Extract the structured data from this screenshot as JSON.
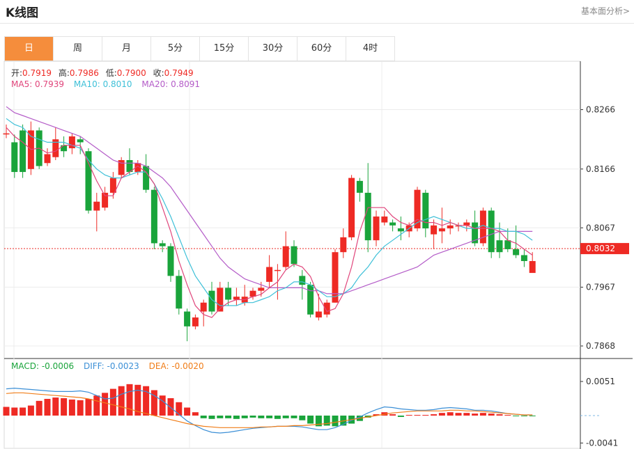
{
  "header": {
    "title": "K线图",
    "link": "基本面分析>"
  },
  "tabs": [
    "日",
    "周",
    "月",
    "5分",
    "15分",
    "30分",
    "60分",
    "4时"
  ],
  "active_tab": 0,
  "ohlc_labels": {
    "open_label": "开:",
    "open": "0.7919",
    "high_label": "高:",
    "high": "0.7986",
    "low_label": "低:",
    "low": "0.7900",
    "close_label": "收:",
    "close": "0.7949"
  },
  "ma_labels": {
    "ma5": "MA5: 0.7939",
    "ma10": "MA10: 0.8010",
    "ma20": "MA20: 0.8091"
  },
  "macd_labels": {
    "macd": "MACD: -0.0006",
    "diff": "DIFF: -0.0023",
    "dea": "DEA: -0.0020"
  },
  "price_axis": {
    "ticks": [
      0.8266,
      0.8166,
      0.8067,
      0.7967,
      0.7868
    ],
    "tick_labels": [
      "0.8266",
      "0.8166",
      "0.8067",
      "0.7967",
      "0.7868"
    ],
    "current_price": 0.8032,
    "current_label": "0.8032"
  },
  "macd_axis": {
    "ticks": [
      0.0051,
      -0.0041
    ],
    "tick_labels": [
      "0.0051",
      "-0.0041"
    ]
  },
  "colors": {
    "up": "#ee2a24",
    "down": "#1aa43b",
    "ma5": "#e0457b",
    "ma10": "#3ec0d8",
    "ma20": "#b45cc8",
    "diff": "#3b8fd6",
    "dea": "#f07d18",
    "accent": "#f58d3c"
  },
  "chart_data": {
    "type": "candlestick",
    "candles": [
      [
        0.8226,
        0.8226,
        0.8241,
        0.8218
      ],
      [
        0.8211,
        0.8161,
        0.8224,
        0.8151
      ],
      [
        0.8231,
        0.8161,
        0.8241,
        0.8151
      ],
      [
        0.8166,
        0.8231,
        0.8246,
        0.8156
      ],
      [
        0.8231,
        0.8171,
        0.8236,
        0.8166
      ],
      [
        0.8176,
        0.8191,
        0.8201,
        0.8171
      ],
      [
        0.8186,
        0.8216,
        0.8236,
        0.8181
      ],
      [
        0.8206,
        0.8196,
        0.8221,
        0.8186
      ],
      [
        0.8201,
        0.8221,
        0.8226,
        0.8191
      ],
      [
        0.8216,
        0.8211,
        0.8221,
        0.8191
      ],
      [
        0.8196,
        0.8096,
        0.8201,
        0.8091
      ],
      [
        0.8096,
        0.8111,
        0.8126,
        0.8061
      ],
      [
        0.8101,
        0.8126,
        0.8136,
        0.8096
      ],
      [
        0.8126,
        0.8151,
        0.8161,
        0.8116
      ],
      [
        0.8156,
        0.8181,
        0.8186,
        0.8151
      ],
      [
        0.8181,
        0.8161,
        0.8201,
        0.8156
      ],
      [
        0.8161,
        0.8176,
        0.8181,
        0.8156
      ],
      [
        0.8171,
        0.8131,
        0.8191,
        0.8126
      ],
      [
        0.8131,
        0.8041,
        0.8136,
        0.8031
      ],
      [
        0.8041,
        0.8036,
        0.8046,
        0.8026
      ],
      [
        0.8036,
        0.7986,
        0.8041,
        0.7976
      ],
      [
        0.7986,
        0.7931,
        0.7996,
        0.7921
      ],
      [
        0.7926,
        0.7901,
        0.7931,
        0.7876
      ],
      [
        0.7901,
        0.7916,
        0.7921,
        0.7896
      ],
      [
        0.7926,
        0.7941,
        0.7946,
        0.7901
      ],
      [
        0.7961,
        0.7926,
        0.7976,
        0.7921
      ],
      [
        0.7926,
        0.7966,
        0.7976,
        0.7926
      ],
      [
        0.7966,
        0.7946,
        0.7976,
        0.7936
      ],
      [
        0.7946,
        0.7951,
        0.7966,
        0.7936
      ],
      [
        0.7941,
        0.7951,
        0.7971,
        0.7936
      ],
      [
        0.7951,
        0.7961,
        0.7966,
        0.7946
      ],
      [
        0.7961,
        0.7966,
        0.7976,
        0.7951
      ],
      [
        0.7976,
        0.8001,
        0.8021,
        0.7966
      ],
      [
        0.7996,
        0.7996,
        0.8006,
        0.7946
      ],
      [
        0.8001,
        0.8036,
        0.8061,
        0.7996
      ],
      [
        0.8036,
        0.8006,
        0.8046,
        0.8001
      ],
      [
        0.7986,
        0.7971,
        0.7996,
        0.7946
      ],
      [
        0.7971,
        0.7921,
        0.7976,
        0.7916
      ],
      [
        0.7916,
        0.7926,
        0.7956,
        0.7911
      ],
      [
        0.7921,
        0.7941,
        0.7946,
        0.7916
      ],
      [
        0.7941,
        0.8026,
        0.8031,
        0.7941
      ],
      [
        0.8026,
        0.8051,
        0.8066,
        0.8016
      ],
      [
        0.8051,
        0.8151,
        0.8156,
        0.8046
      ],
      [
        0.8146,
        0.8126,
        0.8151,
        0.8111
      ],
      [
        0.8126,
        0.8046,
        0.8176,
        0.8026
      ],
      [
        0.8046,
        0.8086,
        0.8096,
        0.8036
      ],
      [
        0.8076,
        0.8086,
        0.8096,
        0.8071
      ],
      [
        0.8076,
        0.8071,
        0.8081,
        0.8061
      ],
      [
        0.8066,
        0.8061,
        0.8086,
        0.8046
      ],
      [
        0.8061,
        0.8071,
        0.8076,
        0.8051
      ],
      [
        0.8066,
        0.8131,
        0.8136,
        0.8061
      ],
      [
        0.8126,
        0.8066,
        0.8131,
        0.8051
      ],
      [
        0.8056,
        0.8071,
        0.8081,
        0.8031
      ],
      [
        0.8061,
        0.8066,
        0.8101,
        0.8041
      ],
      [
        0.8066,
        0.8071,
        0.8081,
        0.8056
      ],
      [
        0.8071,
        0.8071,
        0.8076,
        0.8061
      ],
      [
        0.8071,
        0.8076,
        0.8081,
        0.8061
      ],
      [
        0.8076,
        0.8041,
        0.8096,
        0.8036
      ],
      [
        0.8041,
        0.8096,
        0.8101,
        0.8036
      ],
      [
        0.8096,
        0.8026,
        0.8101,
        0.8016
      ],
      [
        0.8046,
        0.8026,
        0.8076,
        0.8016
      ],
      [
        0.8046,
        0.8031,
        0.8066,
        0.8026
      ],
      [
        0.8031,
        0.8021,
        0.8071,
        0.8016
      ],
      [
        0.8021,
        0.8011,
        0.8031,
        0.8001
      ],
      [
        0.7991,
        0.8011,
        0.8026,
        0.8001
      ]
    ],
    "ma5": [
      0.8236,
      0.8221,
      0.8211,
      0.8199,
      0.8201,
      0.8193,
      0.8196,
      0.8206,
      0.8206,
      0.8206,
      0.8176,
      0.8146,
      0.8121,
      0.8121,
      0.8151,
      0.8161,
      0.8171,
      0.8161,
      0.8141,
      0.8101,
      0.8061,
      0.8011,
      0.7971,
      0.7936,
      0.7921,
      0.7916,
      0.7931,
      0.7941,
      0.7946,
      0.7946,
      0.7951,
      0.7955,
      0.7966,
      0.7976,
      0.7996,
      0.8006,
      0.8001,
      0.7985,
      0.7951,
      0.7926,
      0.7931,
      0.7956,
      0.8001,
      0.8061,
      0.8101,
      0.8101,
      0.8101,
      0.8086,
      0.8076,
      0.8071,
      0.8081,
      0.8076,
      0.8076,
      0.8071,
      0.8076,
      0.8071,
      0.8071,
      0.8066,
      0.8066,
      0.8066,
      0.8061,
      0.8046,
      0.8041,
      0.8031,
      0.8021
    ],
    "ma10": [
      0.8251,
      0.8241,
      0.8236,
      0.8221,
      0.8216,
      0.8211,
      0.8211,
      0.8211,
      0.8206,
      0.8201,
      0.8181,
      0.8166,
      0.8156,
      0.8151,
      0.8151,
      0.8156,
      0.8161,
      0.8161,
      0.8141,
      0.8116,
      0.8086,
      0.8051,
      0.8016,
      0.7986,
      0.7966,
      0.7946,
      0.7936,
      0.7936,
      0.7936,
      0.7941,
      0.7941,
      0.7946,
      0.7951,
      0.7961,
      0.7966,
      0.7976,
      0.7976,
      0.7971,
      0.7961,
      0.7951,
      0.7951,
      0.7956,
      0.7966,
      0.7986,
      0.8001,
      0.8021,
      0.8036,
      0.8046,
      0.8056,
      0.8066,
      0.8076,
      0.8081,
      0.8086,
      0.8081,
      0.8076,
      0.8071,
      0.8066,
      0.8066,
      0.8071,
      0.8066,
      0.8066,
      0.8061,
      0.8061,
      0.8056,
      0.8046
    ],
    "ma20": [
      0.8271,
      0.8261,
      0.8256,
      0.8251,
      0.8246,
      0.8241,
      0.8236,
      0.8231,
      0.8226,
      0.8221,
      0.8211,
      0.8201,
      0.8191,
      0.8181,
      0.8176,
      0.8176,
      0.8176,
      0.8171,
      0.8161,
      0.8151,
      0.8136,
      0.8116,
      0.8096,
      0.8076,
      0.8056,
      0.8036,
      0.8016,
      0.8001,
      0.7991,
      0.7981,
      0.7976,
      0.7971,
      0.7966,
      0.7966,
      0.7966,
      0.7966,
      0.7966,
      0.7961,
      0.7961,
      0.7956,
      0.7956,
      0.7956,
      0.7961,
      0.7966,
      0.7971,
      0.7976,
      0.7981,
      0.7986,
      0.7991,
      0.7996,
      0.8001,
      0.8011,
      0.8021,
      0.8026,
      0.8031,
      0.8036,
      0.8041,
      0.8046,
      0.8051,
      0.8056,
      0.8061,
      0.8061,
      0.8061,
      0.8061,
      0.8061
    ],
    "macd": [
      0.0013,
      0.0012,
      0.0012,
      0.0015,
      0.0022,
      0.0025,
      0.0027,
      0.0026,
      0.0024,
      0.0023,
      0.0025,
      0.003,
      0.0034,
      0.004,
      0.0044,
      0.0047,
      0.0046,
      0.0044,
      0.0038,
      0.003,
      0.0026,
      0.002,
      0.0012,
      0.0005,
      -0.0004,
      -0.0005,
      -0.0004,
      -0.0004,
      -0.0005,
      -0.0004,
      -0.0003,
      -0.0004,
      -0.0004,
      -0.0005,
      -0.0004,
      -0.0004,
      -0.0007,
      -0.0012,
      -0.0016,
      -0.0015,
      -0.0016,
      -0.0015,
      -0.0012,
      -0.0008,
      -0.0003,
      0.0002,
      0.0005,
      0.0002,
      -0.0002,
      0.0001,
      0.0001,
      0.0001,
      0.0002,
      0.0004,
      0.0005,
      0.0004,
      0.0004,
      0.0003,
      0.0004,
      0.0003,
      0.0002,
      0.0001,
      -0.0001,
      -0.0001,
      -0.0001
    ],
    "diff": [
      0.004,
      0.0041,
      0.004,
      0.0039,
      0.0038,
      0.0037,
      0.0036,
      0.0036,
      0.0036,
      0.0037,
      0.0035,
      0.003,
      0.0025,
      0.0026,
      0.0032,
      0.0036,
      0.0038,
      0.0036,
      0.003,
      0.0022,
      0.0012,
      0.0002,
      -0.0008,
      -0.0015,
      -0.0021,
      -0.0025,
      -0.0026,
      -0.0025,
      -0.0023,
      -0.0021,
      -0.0019,
      -0.0018,
      -0.0017,
      -0.0016,
      -0.0016,
      -0.0016,
      -0.0017,
      -0.0019,
      -0.0021,
      -0.0021,
      -0.0018,
      -0.0013,
      -0.0007,
      -0.0002,
      0.0004,
      0.0009,
      0.0013,
      0.0012,
      0.001,
      0.0009,
      0.0008,
      0.0008,
      0.0009,
      0.0011,
      0.0012,
      0.0011,
      0.001,
      0.0008,
      0.0008,
      0.0007,
      0.0005,
      0.0003,
      0.0002,
      0.0001,
      0.0001
    ],
    "dea": [
      0.0033,
      0.0034,
      0.0034,
      0.0033,
      0.0032,
      0.0031,
      0.003,
      0.0029,
      0.0028,
      0.0027,
      0.0025,
      0.0022,
      0.0019,
      0.0016,
      0.0013,
      0.001,
      0.0006,
      0.0003,
      0.0,
      -0.0003,
      -0.0006,
      -0.0009,
      -0.0012,
      -0.0014,
      -0.0016,
      -0.0017,
      -0.0018,
      -0.0018,
      -0.0018,
      -0.0018,
      -0.0018,
      -0.0017,
      -0.0017,
      -0.0016,
      -0.0016,
      -0.0015,
      -0.0015,
      -0.0014,
      -0.0013,
      -0.0012,
      -0.001,
      -0.0008,
      -0.0006,
      -0.0004,
      -0.0002,
      0.0,
      0.0002,
      0.0004,
      0.0005,
      0.0006,
      0.0007,
      0.0007,
      0.0007,
      0.0007,
      0.0008,
      0.0008,
      0.0007,
      0.0007,
      0.0006,
      0.0005,
      0.0004,
      0.0003,
      0.0002,
      0.0001,
      0.0001
    ]
  }
}
